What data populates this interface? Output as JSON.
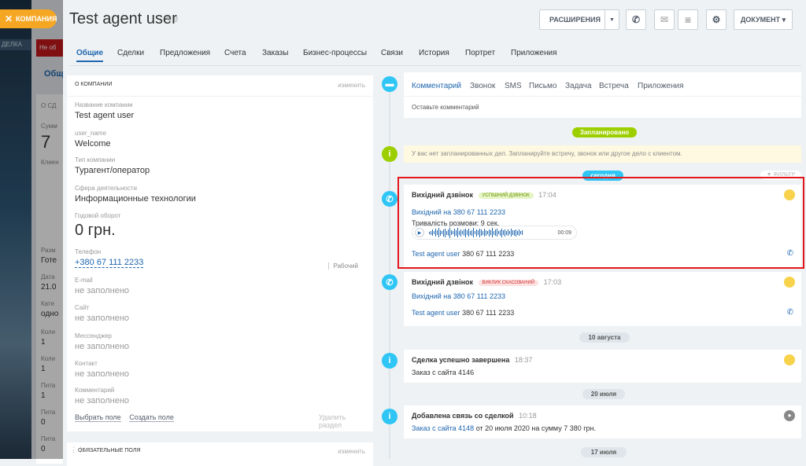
{
  "background": {
    "deal_label": "ДЕЛКА",
    "company_pill": "КОМПАНИЯ",
    "under_red": "Не об",
    "under_tab": "Общ",
    "under_card": {
      "heading": "О СД",
      "sum_label": "Сумм",
      "sum_value": "7",
      "client_label": "Клиен",
      "rows": [
        "Разм",
        "Готе",
        "Дата",
        "21.0",
        "Кате",
        "одно",
        "Коли",
        "1",
        "Коли",
        "1",
        "Пита",
        "1",
        "Пита",
        "0",
        "Пита",
        "0"
      ]
    }
  },
  "header": {
    "title": "Test agent  user",
    "toolbar": {
      "extensions": "РАСШИРЕНИЯ",
      "document": "ДОКУМЕНТ"
    }
  },
  "tabs": [
    "Общие",
    "Сделки",
    "Предложения",
    "Счета",
    "Заказы",
    "Бизнес-процессы",
    "Связи",
    "История",
    "Портрет",
    "Приложения"
  ],
  "about": {
    "header": "О КОМПАНИИ",
    "edit": "изменить",
    "fields": [
      {
        "label": "Название компании",
        "value": "Test agent user"
      },
      {
        "label": "user_name",
        "value": "Welcome"
      },
      {
        "label": "Тип компании",
        "value": "Турагент/оператор"
      },
      {
        "label": "Сфера деятельности",
        "value": "Информационные технологии"
      },
      {
        "label": "Годовой оборот",
        "value": "0 грн."
      },
      {
        "label": "Телефон",
        "value": "+380 67 111 2233",
        "tag": "Рабочий"
      },
      {
        "label": "E-mail",
        "value": "не заполнено"
      },
      {
        "label": "Сайт",
        "value": "не заполнено"
      },
      {
        "label": "Мессенджер",
        "value": "не заполнено"
      },
      {
        "label": "Контакт",
        "value": "не заполнено"
      },
      {
        "label": "Комментарий",
        "value": "не заполнено"
      }
    ],
    "footer": {
      "select": "Выбрать поле",
      "create": "Создать поле",
      "delete": "Удалить раздел"
    }
  },
  "required": {
    "header": "ОБЯЗАТЕЛЬНЫЕ ПОЛЯ",
    "edit": "изменить"
  },
  "comment": {
    "tabs": [
      "Комментарий",
      "Звонок",
      "SMS",
      "Письмо",
      "Задача",
      "Встреча",
      "Приложения"
    ],
    "placeholder": "Оставьте комментарий"
  },
  "timeline": {
    "planned_badge": "Запланировано",
    "notice": "У вас нет запланированных дел. Запланируйте встречу, звонок или другое дело с клиентом.",
    "today_badge": "сегодня",
    "filter": "ФИЛЬТР",
    "call1": {
      "title": "Вихідний дзвінок",
      "status": "УСПІШНИЙ ДЗВІНОК",
      "time": "17:04",
      "link": "Вихідний на 380 67 111 2233",
      "duration": "Тривалість розмови: 9 сек.",
      "player_time": "00:09",
      "contact_name": "Test agent user",
      "contact_phone": "380 67 111 2233"
    },
    "call2": {
      "title": "Вихідний дзвінок",
      "status": "ВИКЛИК СКАСОВАНИЙ",
      "time": "17:03",
      "link": "Вихідний на 380 67 111 2233",
      "contact_name": "Test agent user",
      "contact_phone": "380 67 111 2233"
    },
    "date1": "10 августа",
    "deal": {
      "title": "Сделка успешно завершена",
      "time": "18:37",
      "text": "Заказ с сайта 4146"
    },
    "date2": "20 июля",
    "link_item": {
      "title": "Добавлена связь со сделкой",
      "time": "10:18",
      "link": "Заказ с сайта 4148",
      "rest": " от 20 июля 2020 на сумму 7 380 грн."
    },
    "date3": "17 июля"
  },
  "colors": {
    "accent": "#2067b0",
    "timeline_icon": "#2fc6f6",
    "info_icon": "#9dcf00",
    "highlight": "#e3161b"
  }
}
